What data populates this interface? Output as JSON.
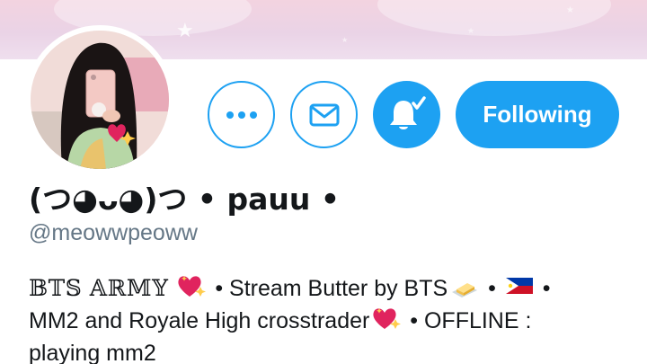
{
  "profile": {
    "display_name": "(つ◕ᴗ◕)つ • pauu •",
    "handle": "@meowwpeoww",
    "bio": {
      "segment_army": "𝔹𝕋𝕊 𝔸ℝ𝕄𝕐",
      "segment_stream": " • Stream Butter by BTS",
      "segment_after_flag": " •",
      "segment_mm2": "MM2 and Royale High crosstrader",
      "segment_offline": " • OFFLINE :",
      "segment_playing": "playing mm2"
    }
  },
  "actions": {
    "follow_label": "Following"
  },
  "icons": {
    "more": "more-options-icon",
    "mail": "envelope-icon",
    "bell": "notification-bell-check-icon",
    "heart": "sparkling-heart-emoji",
    "butter": "butter-emoji",
    "flag": "philippines-flag-emoji"
  },
  "colors": {
    "accent": "#1da1f2",
    "secondary_text": "#657786",
    "primary_text": "#14171a"
  }
}
